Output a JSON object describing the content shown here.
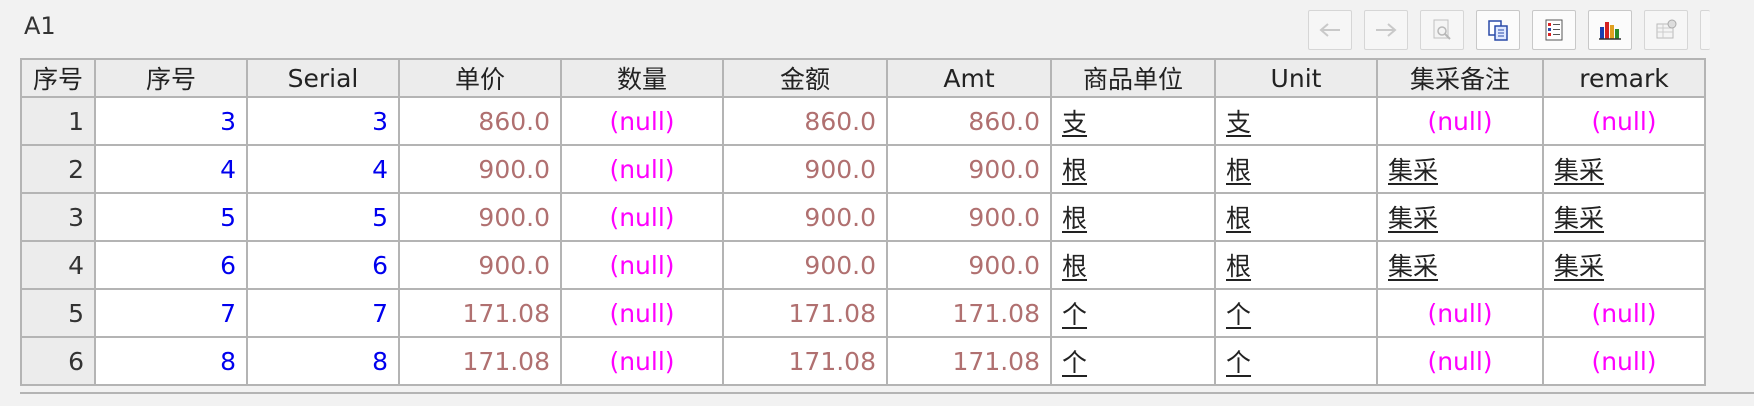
{
  "cell_reference": "A1",
  "toolbar": {
    "buttons": [
      {
        "icon": "arrow-left-icon",
        "enabled": false
      },
      {
        "icon": "arrow-right-icon",
        "enabled": false
      },
      {
        "icon": "magnifier-page-icon",
        "enabled": false
      },
      {
        "icon": "copy-icon",
        "enabled": true
      },
      {
        "icon": "list-icon",
        "enabled": true
      },
      {
        "icon": "bar-chart-icon",
        "enabled": true
      },
      {
        "icon": "settings-table-icon",
        "enabled": false
      }
    ]
  },
  "columns": [
    "序号",
    "序号",
    "Serial",
    "单价",
    "数量",
    "金额",
    "Amt",
    "商品单位",
    "Unit",
    "集采备注",
    "remark"
  ],
  "rows": [
    [
      "1",
      "3",
      "3",
      "860.0",
      "(null)",
      "860.0",
      "860.0",
      "支",
      "支",
      "(null)",
      "(null)"
    ],
    [
      "2",
      "4",
      "4",
      "900.0",
      "(null)",
      "900.0",
      "900.0",
      "根",
      "根",
      "集采",
      "集采"
    ],
    [
      "3",
      "5",
      "5",
      "900.0",
      "(null)",
      "900.0",
      "900.0",
      "根",
      "根",
      "集采",
      "集采"
    ],
    [
      "4",
      "6",
      "6",
      "900.0",
      "(null)",
      "900.0",
      "900.0",
      "根",
      "根",
      "集采",
      "集采"
    ],
    [
      "5",
      "7",
      "7",
      "171.08",
      "(null)",
      "171.08",
      "171.08",
      "个",
      "个",
      "(null)",
      "(null)"
    ],
    [
      "6",
      "8",
      "8",
      "171.08",
      "(null)",
      "171.08",
      "171.08",
      "个",
      "个",
      "(null)",
      "(null)"
    ]
  ],
  "colors": {
    "integer_value": "#0000ee",
    "decimal_value": "#b07070",
    "null_value": "#ff00ff",
    "grid_line": "#b4b4b4",
    "header_bg": "#ececec"
  }
}
